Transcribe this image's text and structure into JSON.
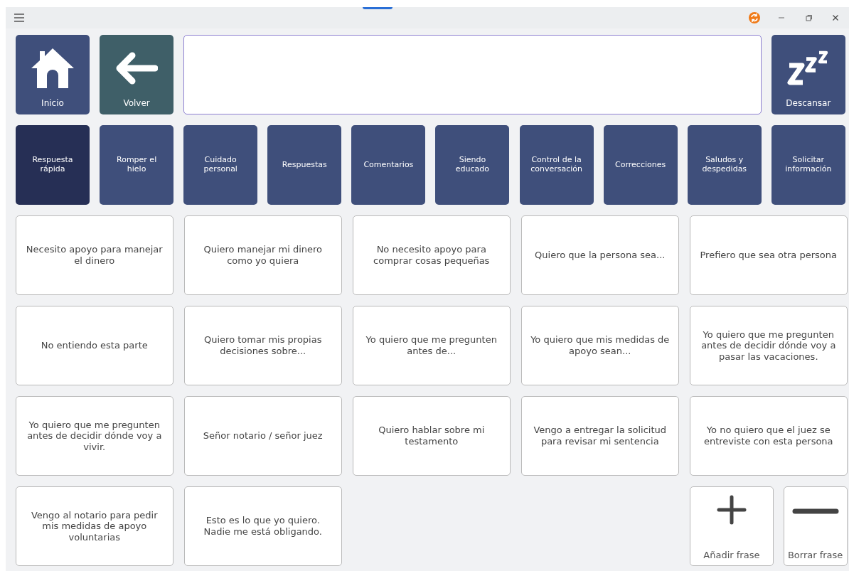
{
  "title_bar": {
    "controls": [
      {
        "kind": "sync"
      },
      {
        "kind": "minimize"
      },
      {
        "kind": "restore"
      },
      {
        "kind": "close"
      }
    ]
  },
  "top_buttons": [
    {
      "kind": "home",
      "label": "Inicio"
    },
    {
      "kind": "back",
      "label": "Volver"
    },
    {
      "kind": "sleep",
      "label": "Descansar"
    }
  ],
  "categories": [
    {
      "label": "Respuesta rápida",
      "selected": true
    },
    {
      "label": "Romper el hielo",
      "selected": false
    },
    {
      "label": "Cuidado personal",
      "selected": false
    },
    {
      "label": "Respuestas",
      "selected": false
    },
    {
      "label": "Comentarios",
      "selected": false
    },
    {
      "label": "Siendo educado",
      "selected": false
    },
    {
      "label": "Control de la conversación",
      "selected": false
    },
    {
      "label": "Correcciones",
      "selected": false
    },
    {
      "label": "Saludos y despedidas",
      "selected": false
    },
    {
      "label": "Solicitar información",
      "selected": false
    }
  ],
  "phrases": [
    "Necesito apoyo para manejar el dinero",
    "Quiero manejar mi dinero como yo quiera",
    "No necesito apoyo para comprar cosas pequeñas",
    "Quiero que la persona sea...",
    "Prefiero que sea otra persona",
    "No entiendo esta parte",
    "Quiero tomar mis propias decisiones sobre...",
    "Yo quiero que me pregunten antes de...",
    "Yo quiero que mis medidas de apoyo sean...",
    "Yo quiero que me pregunten antes de decidir dónde voy a pasar las vacaciones.",
    "Yo quiero que me pregunten antes de decidir dónde voy a vivir.",
    "Señor notario / señor juez",
    "Quiero hablar sobre mi testamento",
    "Vengo a entregar la solicitud para revisar mi sentencia",
    "Yo no quiero que el juez se entreviste con esta persona",
    "Vengo al notario para pedir mis medidas de apoyo voluntarias",
    "Esto es lo que yo quiero. Nadie me está obligando."
  ],
  "actions": [
    {
      "kind": "add",
      "label": "Añadir frase"
    },
    {
      "kind": "remove",
      "label": "Borrar frase"
    }
  ]
}
